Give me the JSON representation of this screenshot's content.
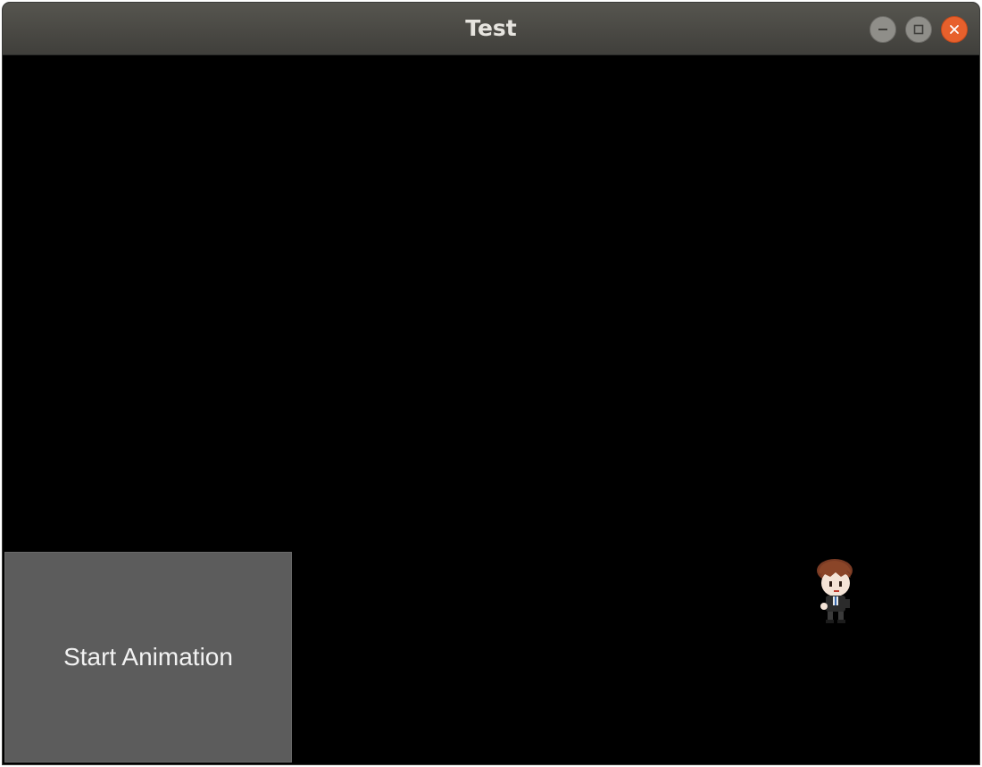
{
  "window": {
    "title": "Test",
    "controls": {
      "minimize_icon": "minimize-icon",
      "maximize_icon": "maximize-icon",
      "close_icon": "close-icon",
      "close_color": "#e7602c"
    }
  },
  "canvas": {
    "background": "#000000",
    "start_button": {
      "label": "Start Animation",
      "color": "#5c5c5c"
    },
    "character": {
      "icon": "character-sprite"
    }
  }
}
